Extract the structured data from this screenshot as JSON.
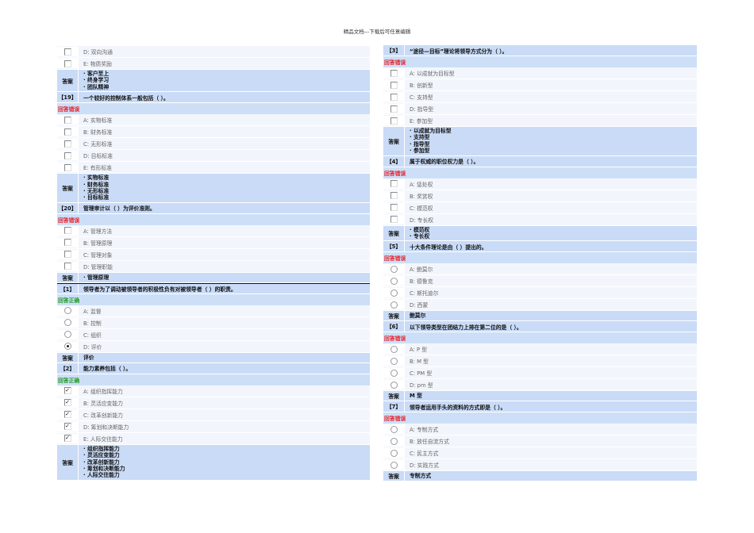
{
  "header": "精品文档---下载后可任意编辑",
  "labels": {
    "answer": "答案",
    "wrong": "回答错误",
    "correct": "回答正确"
  },
  "columns": [
    [
      {
        "type": "option",
        "kind": "checkbox",
        "checked": false,
        "text": "D: 双向沟通"
      },
      {
        "type": "option",
        "kind": "checkbox",
        "checked": false,
        "text": "E: 物质奖励"
      },
      {
        "type": "answer",
        "lines": [
          "· 客户至上",
          "· 终身学习",
          "· 团队精神"
        ]
      },
      {
        "type": "question",
        "num": "【19】",
        "text": "一个较好的控制体系一般包括（ ）。"
      },
      {
        "type": "status",
        "result": "wrong"
      },
      {
        "type": "option",
        "kind": "checkbox",
        "checked": false,
        "text": "A: 实物标准"
      },
      {
        "type": "option",
        "kind": "checkbox",
        "checked": false,
        "text": "B: 财务标准"
      },
      {
        "type": "option",
        "kind": "checkbox",
        "checked": false,
        "text": "C: 无形标准"
      },
      {
        "type": "option",
        "kind": "checkbox",
        "checked": false,
        "text": "D: 目标标准"
      },
      {
        "type": "option",
        "kind": "checkbox",
        "checked": false,
        "text": "E: 有形标准"
      },
      {
        "type": "answer",
        "lines": [
          "· 实物标准",
          "· 财务标准",
          "· 无形标准",
          "· 目标标准"
        ]
      },
      {
        "type": "question",
        "num": "【20】",
        "text": "管理审计以（ ）为评价准则。"
      },
      {
        "type": "status",
        "result": "wrong"
      },
      {
        "type": "option",
        "kind": "checkbox",
        "checked": false,
        "text": "A: 管理方法"
      },
      {
        "type": "option",
        "kind": "checkbox",
        "checked": false,
        "text": "B: 管理原理"
      },
      {
        "type": "option",
        "kind": "checkbox",
        "checked": false,
        "text": "C: 管理对象"
      },
      {
        "type": "option",
        "kind": "checkbox",
        "checked": false,
        "text": "D: 管理职能"
      },
      {
        "type": "answer",
        "lines": [
          "· 管理原理"
        ]
      },
      {
        "type": "question",
        "num": "【1】",
        "text": "领导者为了调动被领导者的积极性负有对被领导者（ ）的职责。",
        "sep": true
      },
      {
        "type": "status",
        "result": "correct"
      },
      {
        "type": "option",
        "kind": "radio",
        "checked": false,
        "text": "A: 监督"
      },
      {
        "type": "option",
        "kind": "radio",
        "checked": false,
        "text": "B: 控制"
      },
      {
        "type": "option",
        "kind": "radio",
        "checked": false,
        "text": "C: 组织"
      },
      {
        "type": "option",
        "kind": "radio",
        "checked": true,
        "text": "D: 评价"
      },
      {
        "type": "answer",
        "lines": [
          "评价"
        ]
      },
      {
        "type": "question",
        "num": "【2】",
        "text": "能力素养包括（ ）。"
      },
      {
        "type": "status",
        "result": "correct"
      },
      {
        "type": "option",
        "kind": "checkbox",
        "checked": true,
        "text": "A: 组织指挥能力"
      },
      {
        "type": "option",
        "kind": "checkbox",
        "checked": true,
        "text": "B: 灵活应变能力"
      },
      {
        "type": "option",
        "kind": "checkbox",
        "checked": true,
        "text": "C: 改革创新能力"
      },
      {
        "type": "option",
        "kind": "checkbox",
        "checked": true,
        "text": "D: 筹划和决断能力"
      },
      {
        "type": "option",
        "kind": "checkbox",
        "checked": true,
        "text": "E: 人际交往能力"
      },
      {
        "type": "answer",
        "lines": [
          "· 组织指挥能力",
          "· 灵活应变能力",
          "· 改革创新能力",
          "· 筹划和决断能力",
          "· 人际交往能力"
        ]
      }
    ],
    [
      {
        "type": "question",
        "num": "【3】",
        "text": "“途径—目标”理论将领导方式分为（ ）。"
      },
      {
        "type": "status",
        "result": "wrong"
      },
      {
        "type": "option",
        "kind": "checkbox",
        "checked": false,
        "text": "A: 以成就为目标型"
      },
      {
        "type": "option",
        "kind": "checkbox",
        "checked": false,
        "text": "B: 创新型"
      },
      {
        "type": "option",
        "kind": "checkbox",
        "checked": false,
        "text": "C: 支持型"
      },
      {
        "type": "option",
        "kind": "checkbox",
        "checked": false,
        "text": "D: 指导型"
      },
      {
        "type": "option",
        "kind": "checkbox",
        "checked": false,
        "text": "E: 参加型"
      },
      {
        "type": "answer",
        "lines": [
          "· 以成就为目标型",
          "· 支持型",
          "· 指导型",
          "· 参加型"
        ]
      },
      {
        "type": "question",
        "num": "【4】",
        "text": "属于权威的职位权力是（ ）。"
      },
      {
        "type": "status",
        "result": "wrong"
      },
      {
        "type": "option",
        "kind": "checkbox",
        "checked": false,
        "text": "A: 惩处权"
      },
      {
        "type": "option",
        "kind": "checkbox",
        "checked": false,
        "text": "B: 奖赏权"
      },
      {
        "type": "option",
        "kind": "checkbox",
        "checked": false,
        "text": "C: 模范权"
      },
      {
        "type": "option",
        "kind": "checkbox",
        "checked": false,
        "text": "D: 专长权"
      },
      {
        "type": "answer",
        "lines": [
          "· 模范权",
          "· 专长权"
        ]
      },
      {
        "type": "question",
        "num": "【5】",
        "text": "十大条件理论是由（ ）提出的。"
      },
      {
        "type": "status",
        "result": "wrong"
      },
      {
        "type": "option",
        "kind": "radio",
        "checked": false,
        "text": "A: 鲍莫尔"
      },
      {
        "type": "option",
        "kind": "radio",
        "checked": false,
        "text": "B: 德鲁克"
      },
      {
        "type": "option",
        "kind": "radio",
        "checked": false,
        "text": "C: 斯托迪尔"
      },
      {
        "type": "option",
        "kind": "radio",
        "checked": false,
        "text": "D: 西蒙"
      },
      {
        "type": "answer",
        "lines": [
          "鲍莫尔"
        ]
      },
      {
        "type": "question",
        "num": "【6】",
        "text": "以下领导类型在团结力上排在第二位的是（ ）。"
      },
      {
        "type": "status",
        "result": "wrong"
      },
      {
        "type": "option",
        "kind": "radio",
        "checked": false,
        "text": "A: P 型"
      },
      {
        "type": "option",
        "kind": "radio",
        "checked": false,
        "text": "B: M 型"
      },
      {
        "type": "option",
        "kind": "radio",
        "checked": false,
        "text": "C: PM 型"
      },
      {
        "type": "option",
        "kind": "radio",
        "checked": false,
        "text": "D: pm 型"
      },
      {
        "type": "answer",
        "lines": [
          "M 型"
        ]
      },
      {
        "type": "question",
        "num": "【7】",
        "text": "领导者运用手头的资料的方式即是（ ）。"
      },
      {
        "type": "status",
        "result": "wrong"
      },
      {
        "type": "option",
        "kind": "radio",
        "checked": false,
        "text": "A: 专制方式"
      },
      {
        "type": "option",
        "kind": "radio",
        "checked": false,
        "text": "B: 放任自流方式"
      },
      {
        "type": "option",
        "kind": "radio",
        "checked": false,
        "text": "C: 民主方式"
      },
      {
        "type": "option",
        "kind": "radio",
        "checked": false,
        "text": "D: 实践方式"
      },
      {
        "type": "answer",
        "lines": [
          "专制方式"
        ]
      }
    ]
  ]
}
